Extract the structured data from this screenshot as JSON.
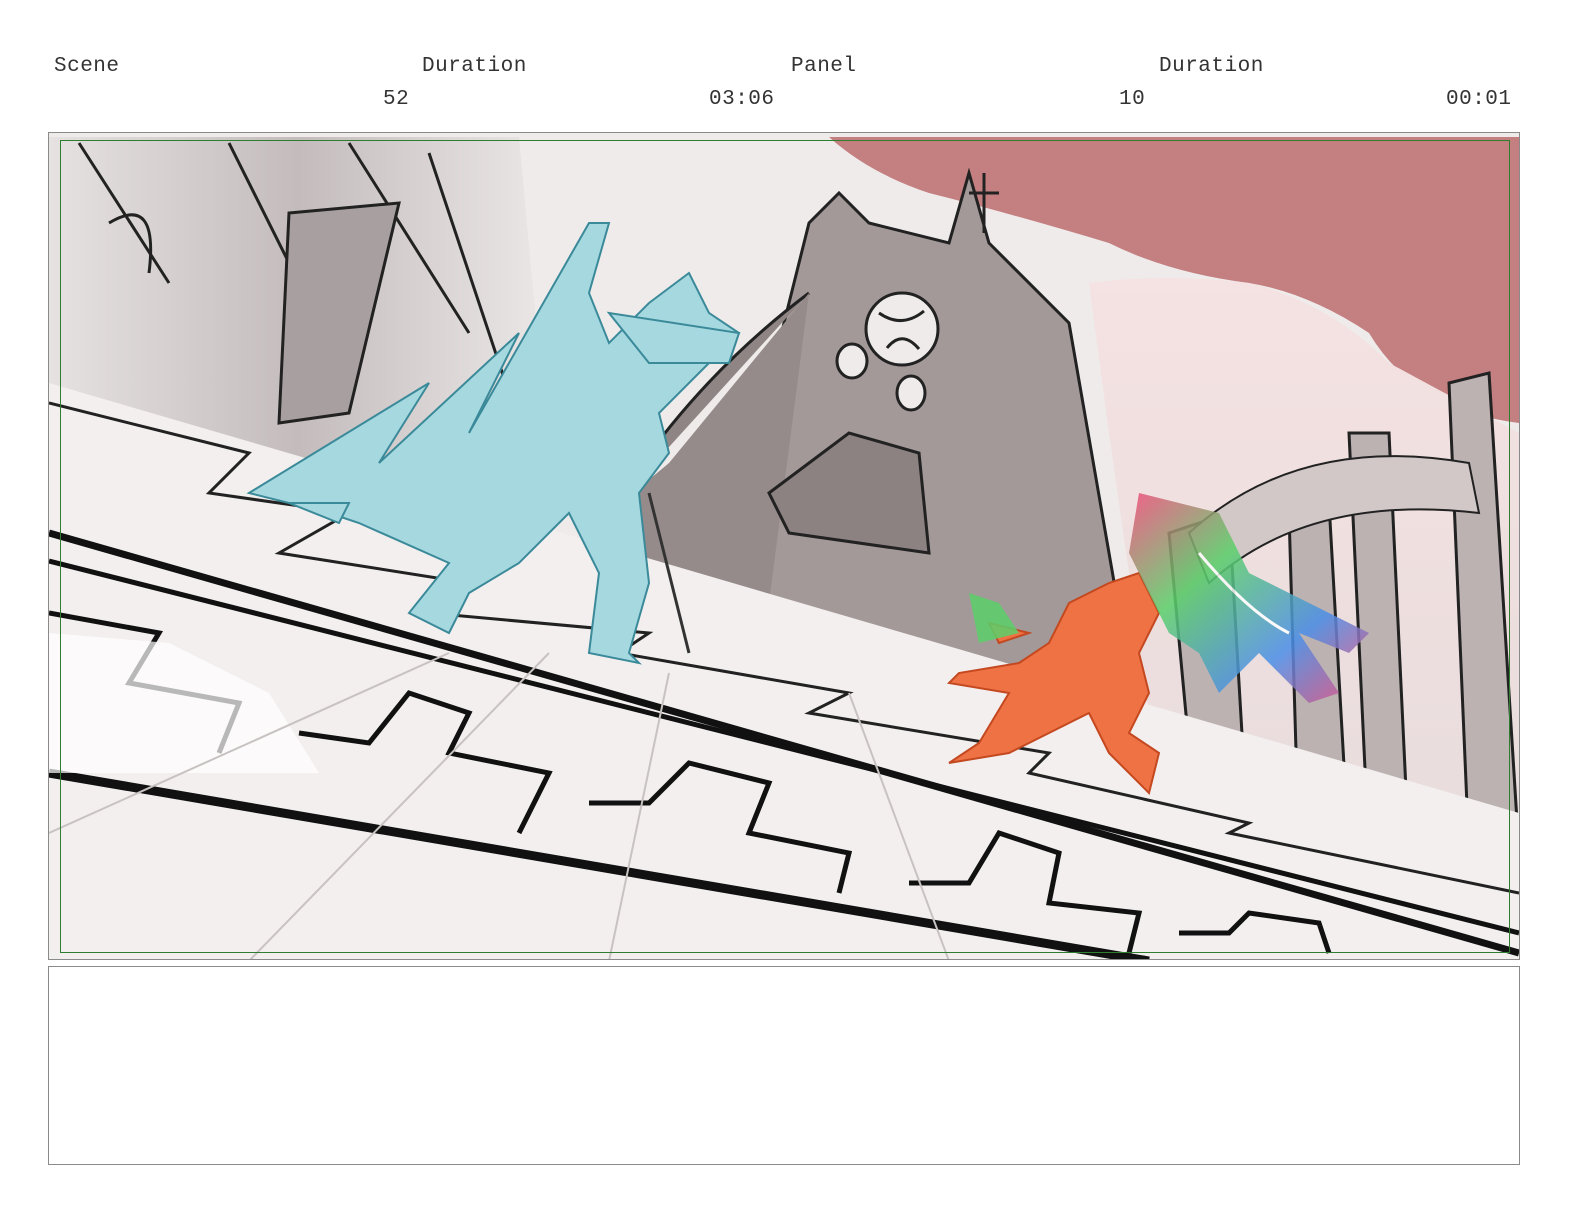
{
  "header": {
    "scene_label": "Scene",
    "duration_label_1": "Duration",
    "panel_label": "Panel",
    "duration_label_2": "Duration",
    "scene_value": "52",
    "scene_duration": "03:06",
    "panel_value": "10",
    "panel_duration": "00:01"
  },
  "panel_image": {
    "colors": {
      "sky_red": "#c47f80",
      "wall_light": "#efebeb",
      "building_gray": "#a39998",
      "left_character": "#a6d8e0",
      "right_character": "#ef7245",
      "safe_frame": "#2f7d2f"
    }
  },
  "notes": {
    "text": ""
  }
}
